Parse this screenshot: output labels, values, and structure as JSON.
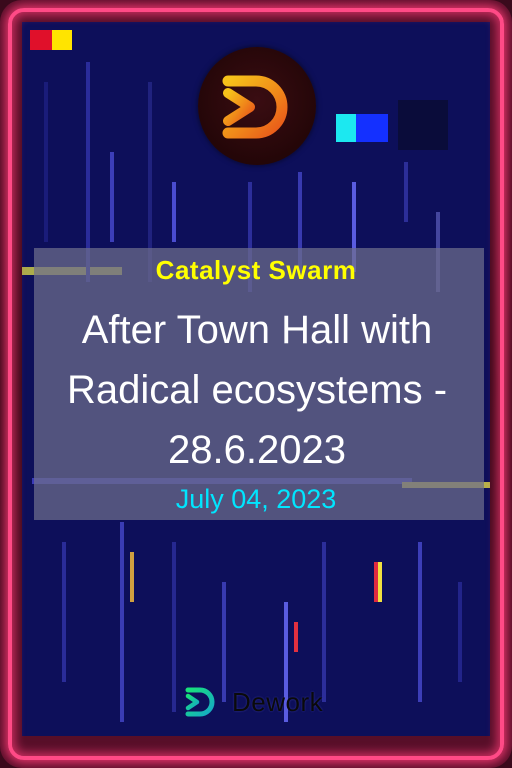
{
  "card": {
    "subtitle": "Catalyst Swarm",
    "title": "After Town Hall with Radical ecosystems - 28.6.2023",
    "date": "July 04, 2023"
  },
  "brand": {
    "name": "Dework",
    "logo_icon": "dework-icon"
  },
  "logo_icon": "dework-circle-logo-icon",
  "colors": {
    "frame": "#ff4a86",
    "background": "#0d0f5a",
    "subtitle": "#ffff00",
    "title": "#ffffff",
    "date": "#00e6ff",
    "panel": "#6e6e8c"
  }
}
